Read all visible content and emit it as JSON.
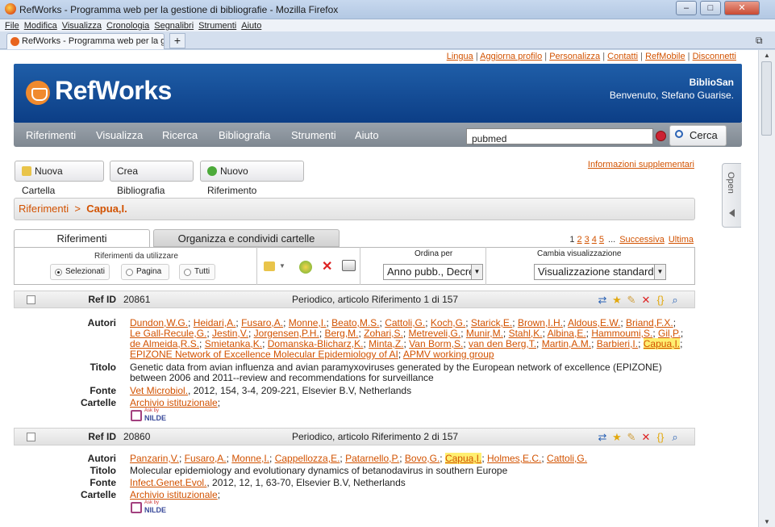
{
  "window": {
    "title": "RefWorks - Programma web per la gestione di bibliografie - Mozilla Firefox",
    "tab_label": "RefWorks - Programma web per la gesti...",
    "new_tab": "+",
    "minimize": "–",
    "maximize": "□",
    "close": "✕"
  },
  "menu": [
    "File",
    "Modifica",
    "Visualizza",
    "Cronologia",
    "Segnalibri",
    "Strumenti",
    "Aiuto"
  ],
  "top_links": [
    "Lingua",
    "Aggiorna profilo",
    "Personalizza",
    "Contatti",
    "RefMobile",
    "Disconnetti"
  ],
  "top_links_sep": "|",
  "brand": {
    "logo": "RefWorks",
    "org": "BiblioSan",
    "welcome": "Benvenuto, Stefano Guarise."
  },
  "nav": [
    "Riferimenti",
    "Visualizza",
    "Ricerca",
    "Bibliografia",
    "Strumenti",
    "Aiuto"
  ],
  "search": {
    "value": "pubmed",
    "button": "Cerca"
  },
  "toolbar": {
    "new_folder": "Nuova Cartella",
    "create_bib": "Crea Bibliografia",
    "new_ref": "Nuovo Riferimento",
    "info": "Informazioni supplementari"
  },
  "open_tab": "Open",
  "breadcrumb": {
    "root": "Riferimenti",
    "sep": ">",
    "current": "Capua,I."
  },
  "tabs": {
    "ref": "Riferimenti",
    "org": "Organizza e condividi cartelle"
  },
  "pager": {
    "pages": [
      "1",
      "2",
      "3",
      "4",
      "5"
    ],
    "ellipsis": "...",
    "next": "Successiva",
    "last": "Ultima"
  },
  "options": {
    "use_label": "Riferimenti da utilizzare",
    "selected": "Selezionati",
    "page": "Pagina",
    "all": "Tutti",
    "sort_label": "Ordina per",
    "sort_value": "Anno pubb., Decre",
    "view_label": "Cambia visualizzazione",
    "view_value": "Visualizzazione standard"
  },
  "labels": {
    "ref_id": "Ref ID",
    "authors": "Autori",
    "title": "Titolo",
    "source": "Fonte",
    "folders": "Cartelle",
    "ask": "Ask by",
    "nilde": "NILDE"
  },
  "records": [
    {
      "id": "20861",
      "type": "Periodico, articolo Riferimento 1 di 157",
      "authors": [
        "Dundon,W.G.",
        "Heidari,A.",
        "Fusaro,A.",
        "Monne,I.",
        "Beato,M.S.",
        "Cattoli,G.",
        "Koch,G.",
        "Starick,E.",
        "Brown,I.H.",
        "Aldous,E.W.",
        "Briand,F.X.",
        "Le Gall-Recule,G.",
        "Jestin,V.",
        "Jorgensen,P.H.",
        "Berg,M.",
        "Zohari,S.",
        "Metreveli,G.",
        "Munir,M.",
        "Stahl,K.",
        "Albina,E.",
        "Hammoumi,S.",
        "Gil,P.",
        "de Almeida,R.S.",
        "Smietanka,K.",
        "Domanska-Blicharz,K.",
        "Minta,Z.",
        "Van Borm,S.",
        "van den Berg,T.",
        "Martin,A.M.",
        "Barbieri,I.",
        "Capua,I.",
        "EPIZONE Network of Excellence Molecular Epidemiology of AI",
        "APMV working group"
      ],
      "title": "Genetic data from avian influenza and avian paramyxoviruses generated by the European network of excellence (EPIZONE) between 2006 and 2011--review and recommendations for surveillance",
      "source_link": "Vet Microbiol.",
      "source_rest": ", 2012, 154, 3-4, 209-221, Elsevier B.V, Netherlands",
      "folder": "Archivio istituzionale"
    },
    {
      "id": "20860",
      "type": "Periodico, articolo Riferimento 2 di 157",
      "authors": [
        "Panzarin,V.",
        "Fusaro,A.",
        "Monne,I.",
        "Cappellozza,E.",
        "Patarnello,P.",
        "Bovo,G.",
        "Capua,I.",
        "Holmes,E.C.",
        "Cattoli,G."
      ],
      "title": "Molecular epidemiology and evolutionary dynamics of betanodavirus in southern Europe",
      "source_link": "Infect.Genet.Evol.",
      "source_rest": ", 2012, 12, 1, 63-70, Elsevier B.V, Netherlands",
      "folder": "Archivio istituzionale"
    }
  ],
  "highlight_author": "Capua,I.",
  "colors": {
    "link": "#d25200",
    "banner": "#1f5ea8",
    "nav": "#8a929b",
    "highlight": "#ffef70"
  }
}
